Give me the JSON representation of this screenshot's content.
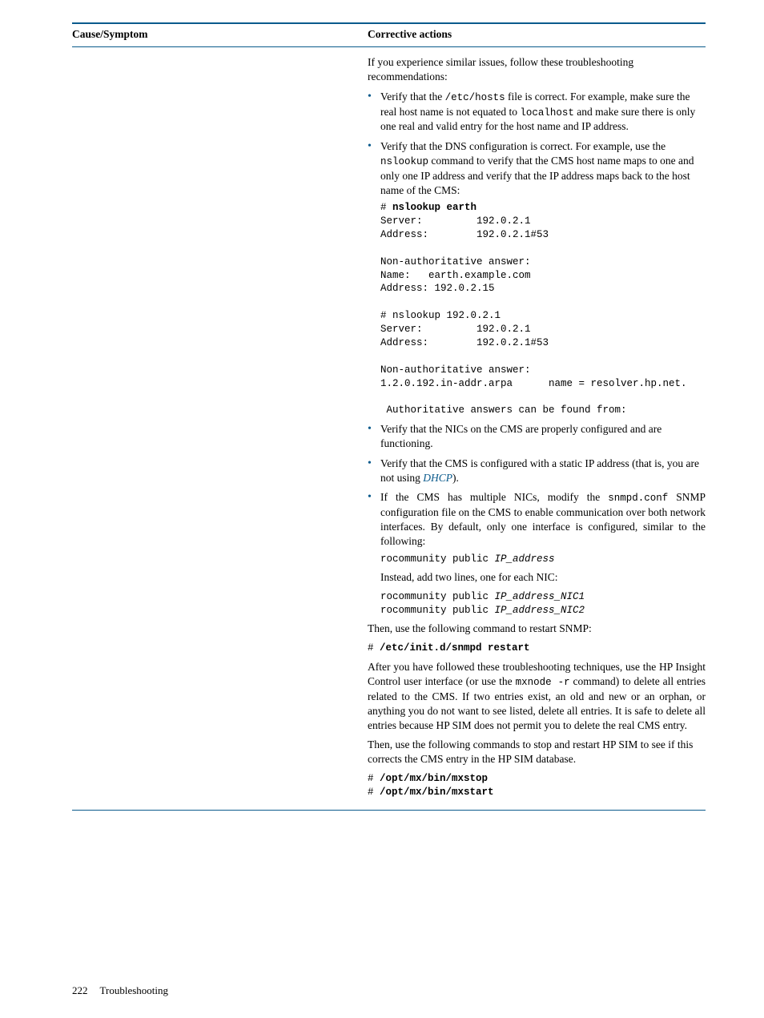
{
  "header": {
    "col1": "Cause/Symptom",
    "col2": "Corrective actions"
  },
  "intro": "If you experience similar issues, follow these troubleshooting recommendations:",
  "bullets1": [
    {
      "pre": "Verify that the ",
      "code1": "/etc/hosts",
      "mid": " file is correct. For example, make sure the real host name is not equated to ",
      "code2": "localhost",
      "post": " and make sure there is only one real and valid entry for the host name and IP address."
    },
    {
      "pre": "Verify that the DNS configuration is correct. For example, use the ",
      "code1": "nslookup",
      "post": " command to verify that the CMS host name maps to one and only one IP address and verify that the IP address maps back to the host name of the CMS:"
    }
  ],
  "term1": "# nslookup earth\nServer:         192.0.2.1\nAddress:        192.0.2.1#53\n\nNon-authoritative answer:\nName:   earth.example.com\nAddress: 192.0.2.15\n\n# nslookup 192.0.2.1\nServer:         192.0.2.1\nAddress:        192.0.2.1#53\n\nNon-authoritative answer:\n1.2.0.192.in-addr.arpa      name = resolver.hp.net.\n\n Authoritative answers can be found from:",
  "term1_bold_lines": [
    0,
    7
  ],
  "bullets2": [
    {
      "text": "Verify that the NICs on the CMS are properly configured and are functioning."
    },
    {
      "pre": "Verify that the CMS is configured with a static IP address (that is, you are not using ",
      "link": "DHCP",
      "post": ")."
    },
    {
      "pre": "If the CMS has multiple NICs, modify the ",
      "code1": "snmpd.conf",
      "post": " SNMP configuration file on the CMS to enable communication over both network interfaces. By default, only one interface is configured, similar to the following:"
    }
  ],
  "rocom_single": {
    "prefix": "rocommunity public ",
    "var": "IP_address"
  },
  "instead_line": "Instead, add two lines, one for each NIC:",
  "rocom_nic1": {
    "prefix": "rocommunity public ",
    "var": "IP_address_NIC1"
  },
  "rocom_nic2": {
    "prefix": "rocommunity public ",
    "var": "IP_address_NIC2"
  },
  "restart_intro": "Then, use the following command to restart SNMP:",
  "restart_cmd": {
    "hash": "# ",
    "cmd": "/etc/init.d/snmpd restart"
  },
  "after_para": {
    "pre": "After you have followed these troubleshooting techniques, use the HP Insight Control user interface (or use the ",
    "code": "mxnode -r",
    "post": " command) to delete all entries related to the CMS. If two entries exist, an old and new or an orphan, or anything you do not want to see listed, delete all entries. It is safe to delete all entries because HP SIM does not permit you to delete the real CMS entry."
  },
  "then_stop": "Then, use the following commands to stop and restart HP SIM to see if this corrects the CMS entry in the HP SIM database.",
  "stop_cmd": {
    "hash": "# ",
    "cmd": "/opt/mx/bin/mxstop"
  },
  "start_cmd": {
    "hash": "# ",
    "cmd": "/opt/mx/bin/mxstart"
  },
  "footer": {
    "page": "222",
    "section": "Troubleshooting"
  }
}
